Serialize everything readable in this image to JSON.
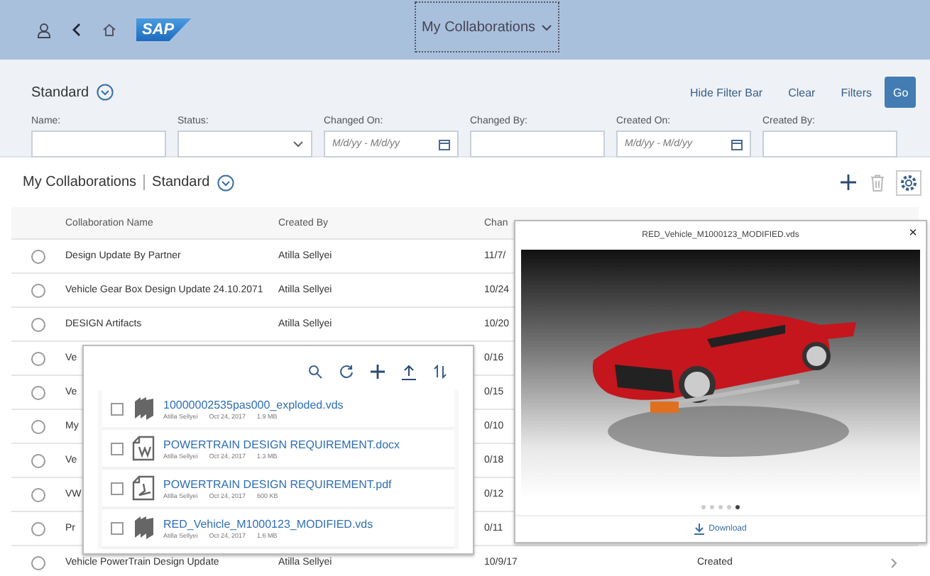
{
  "shell": {
    "logo": "SAP",
    "title": "My Collaborations"
  },
  "filter_bar": {
    "variant": "Standard",
    "actions": [
      "Hide Filter Bar",
      "Clear",
      "Filters"
    ],
    "go": "Go",
    "fields": [
      {
        "label": "Name:",
        "kind": "text"
      },
      {
        "label": "Status:",
        "kind": "select"
      },
      {
        "label": "Changed On:",
        "kind": "date",
        "placeholder": "M/d/yy - M/d/yy"
      },
      {
        "label": "Changed By:",
        "kind": "text"
      },
      {
        "label": "Created On:",
        "kind": "date",
        "placeholder": "M/d/yy - M/d/yy"
      },
      {
        "label": "Created By:",
        "kind": "text"
      }
    ]
  },
  "table": {
    "title": "My Collaborations",
    "variant": "Standard",
    "columns": [
      "Collaboration Name",
      "Created By",
      "Chan"
    ],
    "rows": [
      {
        "name": "Design Update By Partner",
        "created_by": "Atilla Sellyei",
        "changed_on": "11/7/",
        "selected": false
      },
      {
        "name": "Vehicle Gear Box Design Update 24.10.2071",
        "created_by": "Atilla Sellyei",
        "changed_on": "10/24",
        "selected": false
      },
      {
        "name": "DESIGN Artifacts",
        "created_by": "Atilla Sellyei",
        "changed_on": "10/20",
        "selected": false
      },
      {
        "name": "Ve",
        "changed_on": "0/16",
        "selected": false
      },
      {
        "name": "Ve",
        "changed_on": "0/15",
        "selected": false
      },
      {
        "name": "My",
        "changed_on": "0/10",
        "selected": false
      },
      {
        "name": "Ve",
        "changed_on": "0/18",
        "selected": false
      },
      {
        "name": "VW",
        "changed_on": "0/12",
        "selected": false
      },
      {
        "name": "Pr",
        "changed_on": "0/11",
        "selected": false
      },
      {
        "name": "Vehicle PowerTrain Design Update",
        "created_by": "Atilla Sellyei",
        "changed_on": "10/9/17",
        "status": "Created",
        "selected": false
      }
    ]
  },
  "files_panel": {
    "files": [
      {
        "name": "10000002535pas000_exploded.vds",
        "kind": "vds",
        "author": "Atilla Sellyei",
        "date": "Oct 24, 2017",
        "size": "1.9 MB",
        "checked": false
      },
      {
        "name": "POWERTRAIN DESIGN REQUIREMENT.docx",
        "kind": "docx",
        "author": "Atilla Sellyei",
        "date": "Oct 24, 2017",
        "size": "1.3 MB",
        "checked": false
      },
      {
        "name": "POWERTRAIN DESIGN REQUIREMENT.pdf",
        "kind": "pdf",
        "author": "Atilla Sellyei",
        "date": "Oct 24, 2017",
        "size": "600 KB",
        "checked": false
      },
      {
        "name": "RED_Vehicle_M1000123_MODIFIED.vds",
        "kind": "vds",
        "author": "Atilla Sellyei",
        "date": "Oct 24, 2017",
        "size": "1.6 MB",
        "checked": false
      }
    ]
  },
  "viewer": {
    "title": "RED_Vehicle_M1000123_MODIFIED.vds",
    "close": "×",
    "download": "Download",
    "pages": [
      {
        "selected": false
      },
      {
        "selected": false
      },
      {
        "selected": false
      },
      {
        "selected": false
      },
      {
        "selected": true
      }
    ]
  }
}
